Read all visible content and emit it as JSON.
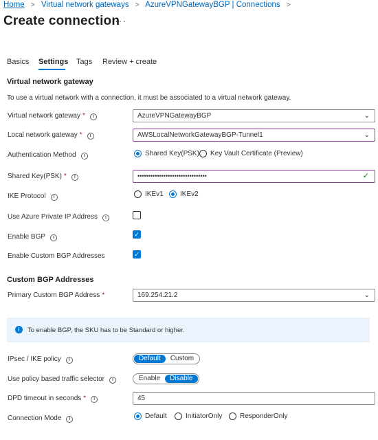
{
  "breadcrumb": {
    "items": [
      "Home",
      "Virtual network gateways",
      "AzureVPNGatewayBGP | Connections"
    ],
    "separator": ">"
  },
  "page": {
    "title": "Create connection",
    "more": "···"
  },
  "tabs": [
    {
      "label": "Basics",
      "active": false
    },
    {
      "label": "Settings",
      "active": true
    },
    {
      "label": "Tags",
      "active": false
    },
    {
      "label": "Review + create",
      "active": false
    }
  ],
  "vng_section": {
    "heading": "Virtual network gateway",
    "description": "To use a virtual network with a connection, it must be associated to a virtual network gateway."
  },
  "form": {
    "vng": {
      "label": "Virtual network gateway",
      "required": "*",
      "value": "AzureVPNGatewayBGP"
    },
    "lng": {
      "label": "Local network gateway",
      "required": "*",
      "value": "AWSLocalNetworkGatewayBGP-Tunnel1"
    },
    "auth": {
      "label": "Authentication Method",
      "options": [
        "Shared Key(PSK)",
        "Key Vault Certificate (Preview)"
      ],
      "selected": "Shared Key(PSK)"
    },
    "psk": {
      "label": "Shared Key(PSK)",
      "required": "*",
      "value": "••••••••••••••••••••••••••••••••"
    },
    "ike": {
      "label": "IKE Protocol",
      "options": [
        "IKEv1",
        "IKEv2"
      ],
      "selected": "IKEv2"
    },
    "private_ip": {
      "label": "Use Azure Private IP Address",
      "checked": false
    },
    "bgp": {
      "label": "Enable BGP",
      "checked": true
    },
    "custom_bgp": {
      "label": "Enable Custom BGP Addresses",
      "checked": true
    }
  },
  "custom_bgp_section": {
    "heading": "Custom BGP Addresses",
    "primary": {
      "label": "Primary Custom BGP Address",
      "required": "*",
      "value": "169.254.21.2"
    }
  },
  "banner": {
    "text": "To enable BGP, the SKU has to be Standard or higher.",
    "icon": "info-icon"
  },
  "advanced": {
    "ipsec": {
      "label": "IPsec / IKE policy",
      "options": [
        "Default",
        "Custom"
      ],
      "selected": "Default"
    },
    "policy_selector": {
      "label": "Use policy based traffic selector",
      "options": [
        "Enable",
        "Disable"
      ],
      "selected": "Disable"
    },
    "dpd": {
      "label": "DPD timeout in seconds",
      "required": "*",
      "value": "45"
    },
    "mode": {
      "label": "Connection Mode",
      "options": [
        "Default",
        "InitiatorOnly",
        "ResponderOnly"
      ],
      "selected": "Default"
    }
  },
  "colors": {
    "accent": "#0078d4",
    "link": "#0067b8",
    "focus_border": "#8f3c9f",
    "required": "#a4262c",
    "banner_bg": "#ebf3fc"
  }
}
